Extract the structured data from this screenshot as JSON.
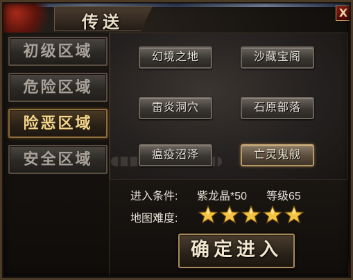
{
  "window": {
    "title": "传送",
    "close_label": "X"
  },
  "sidebar": {
    "items": [
      {
        "label": "初级区域",
        "active": false
      },
      {
        "label": "危险区域",
        "active": false
      },
      {
        "label": "险恶区域",
        "active": true
      },
      {
        "label": "安全区域",
        "active": false
      }
    ]
  },
  "maps": [
    {
      "label": "幻境之地",
      "active": false
    },
    {
      "label": "沙藏宝阁",
      "active": false
    },
    {
      "label": "雷炎洞穴",
      "active": false
    },
    {
      "label": "石原部落",
      "active": false
    },
    {
      "label": "瘟疫沼泽",
      "active": false
    },
    {
      "label": "亡灵鬼舰",
      "active": true
    }
  ],
  "info": {
    "condition_label": "进入条件:",
    "condition_item": "紫龙晶*50",
    "condition_level": "等级65",
    "difficulty_label": "地图难度:",
    "difficulty_stars": 5,
    "difficulty_max": 5
  },
  "confirm": {
    "label": "确定进入"
  },
  "colors": {
    "accent_gold": "#f3d58a",
    "star_gold": "#f5c442",
    "close_red": "#8b1a12"
  },
  "icons": {
    "close": "close-icon",
    "star": "star-icon"
  }
}
